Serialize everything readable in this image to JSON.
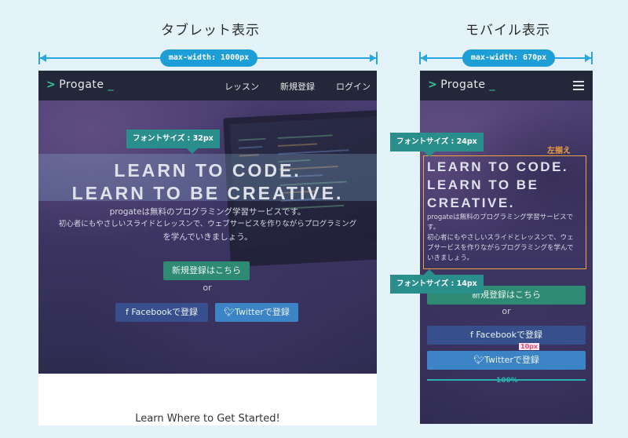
{
  "tablet": {
    "heading": "タブレット表示",
    "max_width_label": "max-width: 1000px",
    "logo": "Progate",
    "nav": [
      "レッスン",
      "新規登録",
      "ログイン"
    ],
    "headline_line1": "LEARN TO CODE.",
    "headline_line2": "LEARN TO BE CREATIVE.",
    "subtext_line1": "progateは無料のプログラミング学習サービスです。",
    "subtext_line2": "初心者にもやさしいスライドとレッスンで、ウェブサービスを作りながらプログラミング",
    "subtext_line3": "を学んでいきましょう。",
    "font_size_callout": "フォントサイズ : 32px",
    "signup_button": "新規登録はこちら",
    "or_text": "or",
    "facebook_button": "f Facebookで登録",
    "twitter_button": "Twitterで登録",
    "footer_text": "Learn Where to Get Started!"
  },
  "mobile": {
    "heading": "モバイル表示",
    "max_width_label": "max-width: 670px",
    "logo": "Progate",
    "headline_line1": "LEARN TO CODE.",
    "headline_line2": "LEARN TO BE",
    "headline_line3": "CREATIVE.",
    "subtext_line1": "progateは無料のプログラミング学習サービスで",
    "subtext_line2": "す。",
    "subtext_line3": "初心者にもやさしいスライドとレッスンで、ウェ",
    "subtext_line4": "ブサービスを作りながらプログラミングを学んで",
    "subtext_line5": "いきましょう。",
    "font_size_callout_top": "フォントサイズ : 24px",
    "font_size_callout_bottom": "フォントサイズ : 14px",
    "left_align_label": "左揃え",
    "signup_button": "新規登録はこちら",
    "or_text": "or",
    "facebook_button": "f Facebookで登録",
    "twitter_button": "Twitterで登録",
    "spacing_label": "10px",
    "width_label": "100%"
  },
  "colors": {
    "accent_blue": "#29a7e1",
    "callout_teal": "#2a8f8c",
    "orange": "#f0a040",
    "pink": "#e04a78",
    "progate_green": "#34c597"
  }
}
